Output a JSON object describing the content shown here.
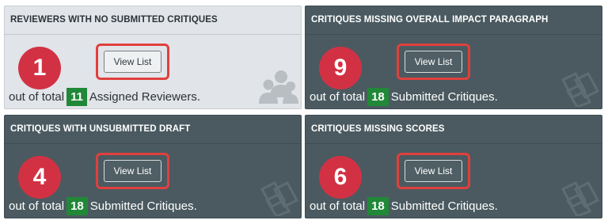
{
  "cards": [
    {
      "title": "REVIEWERS WITH NO SUBMITTED CRITIQUES",
      "count": "1",
      "button_label": "View List",
      "summary_prefix": "out of total",
      "total": "11",
      "summary_suffix": "Assigned Reviewers.",
      "icon": "users-icon",
      "theme": "light"
    },
    {
      "title": "CRITIQUES MISSING OVERALL IMPACT PARAGRAPH",
      "count": "9",
      "button_label": "View List",
      "summary_prefix": "out of total",
      "total": "18",
      "summary_suffix": "Submitted Critiques.",
      "icon": "documents-icon",
      "theme": "dark"
    },
    {
      "title": "CRITIQUES WITH UNSUBMITTED DRAFT",
      "count": "4",
      "button_label": "View List",
      "summary_prefix": "out of total",
      "total": "18",
      "summary_suffix": "Submitted Critiques.",
      "icon": "documents-icon",
      "theme": "dark"
    },
    {
      "title": "CRITIQUES MISSING SCORES",
      "count": "6",
      "button_label": "View List",
      "summary_prefix": "out of total",
      "total": "18",
      "summary_suffix": "Submitted Critiques.",
      "icon": "documents-icon",
      "theme": "dark"
    }
  ],
  "colors": {
    "count_badge": "#d23144",
    "total_badge": "#218838",
    "highlight_outline": "#e0403d",
    "dark_card": "#4a5a60",
    "light_card": "#e1e4e8"
  }
}
